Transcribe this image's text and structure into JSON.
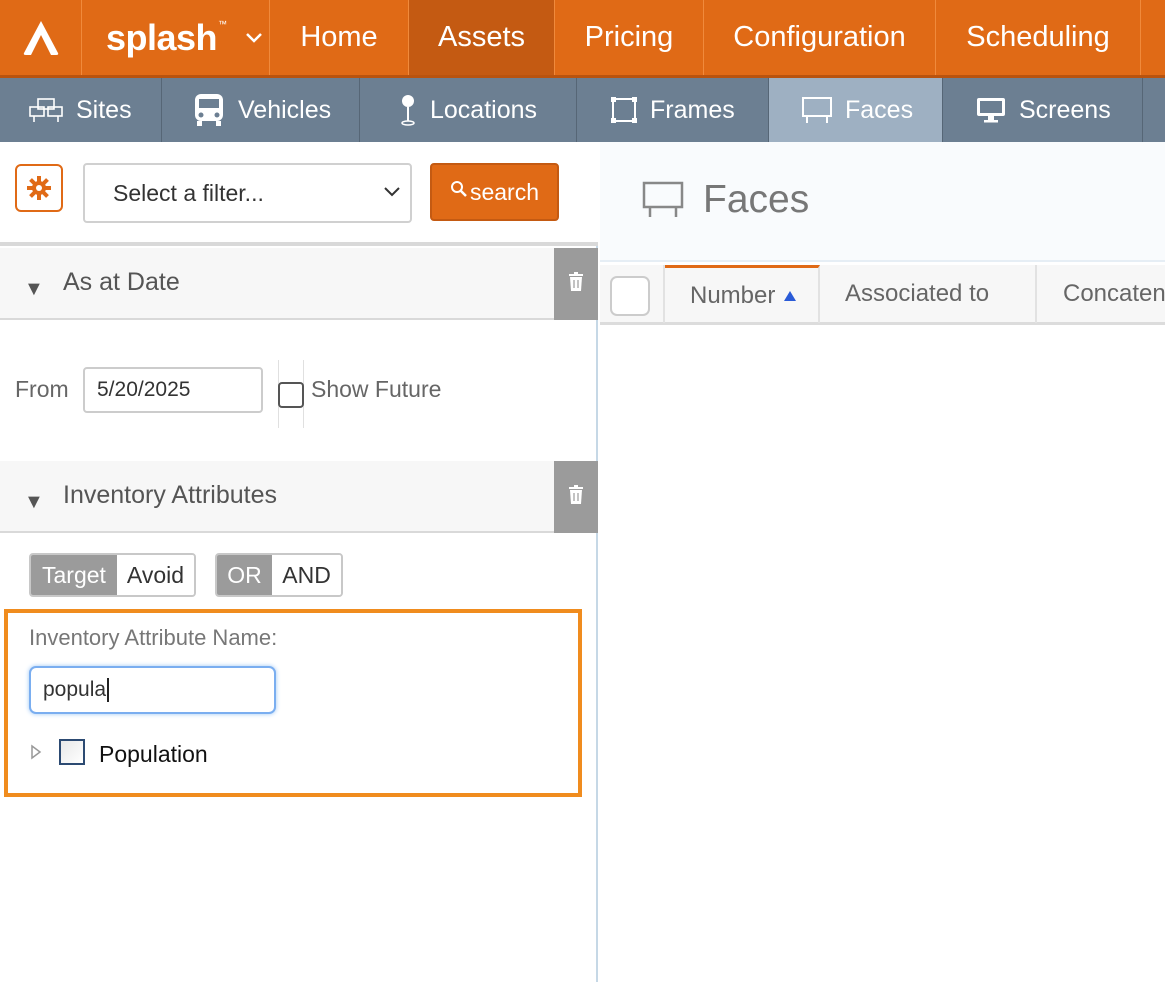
{
  "brand": {
    "name": "splash",
    "trademark": "™"
  },
  "topnav": {
    "items": [
      {
        "label": "Home"
      },
      {
        "label": "Assets"
      },
      {
        "label": "Pricing"
      },
      {
        "label": "Configuration"
      },
      {
        "label": "Scheduling"
      }
    ],
    "active": "Assets"
  },
  "subnav": {
    "items": [
      {
        "label": "Sites",
        "icon": "sites-icon"
      },
      {
        "label": "Vehicles",
        "icon": "bus-icon"
      },
      {
        "label": "Locations",
        "icon": "pin-icon"
      },
      {
        "label": "Frames",
        "icon": "frame-icon"
      },
      {
        "label": "Faces",
        "icon": "billboard-icon"
      },
      {
        "label": "Screens",
        "icon": "monitor-icon"
      }
    ],
    "active": "Faces"
  },
  "toolbar": {
    "filter_placeholder": "Select a filter...",
    "search_label": "search"
  },
  "as_at_date": {
    "title": "As at Date",
    "from_label": "From",
    "from_value": "5/20/2025",
    "show_future_label": "Show Future",
    "show_future_checked": false
  },
  "inventory_attributes": {
    "title": "Inventory Attributes",
    "mode": {
      "target": "Target",
      "avoid": "Avoid",
      "selected": "Target"
    },
    "logic": {
      "or": "OR",
      "and": "AND",
      "selected": "OR"
    },
    "name_label": "Inventory Attribute Name:",
    "name_value": "popula",
    "results": [
      {
        "label": "Population",
        "checked": false
      }
    ]
  },
  "main": {
    "title": "Faces",
    "columns": [
      {
        "label": "Number",
        "sort": "asc"
      },
      {
        "label": "Associated to"
      },
      {
        "label": "Concaten"
      }
    ]
  },
  "colors": {
    "brand_orange": "#e06a16",
    "subnav_slate": "#6c7f92",
    "highlight_box": "#f08c1e"
  }
}
